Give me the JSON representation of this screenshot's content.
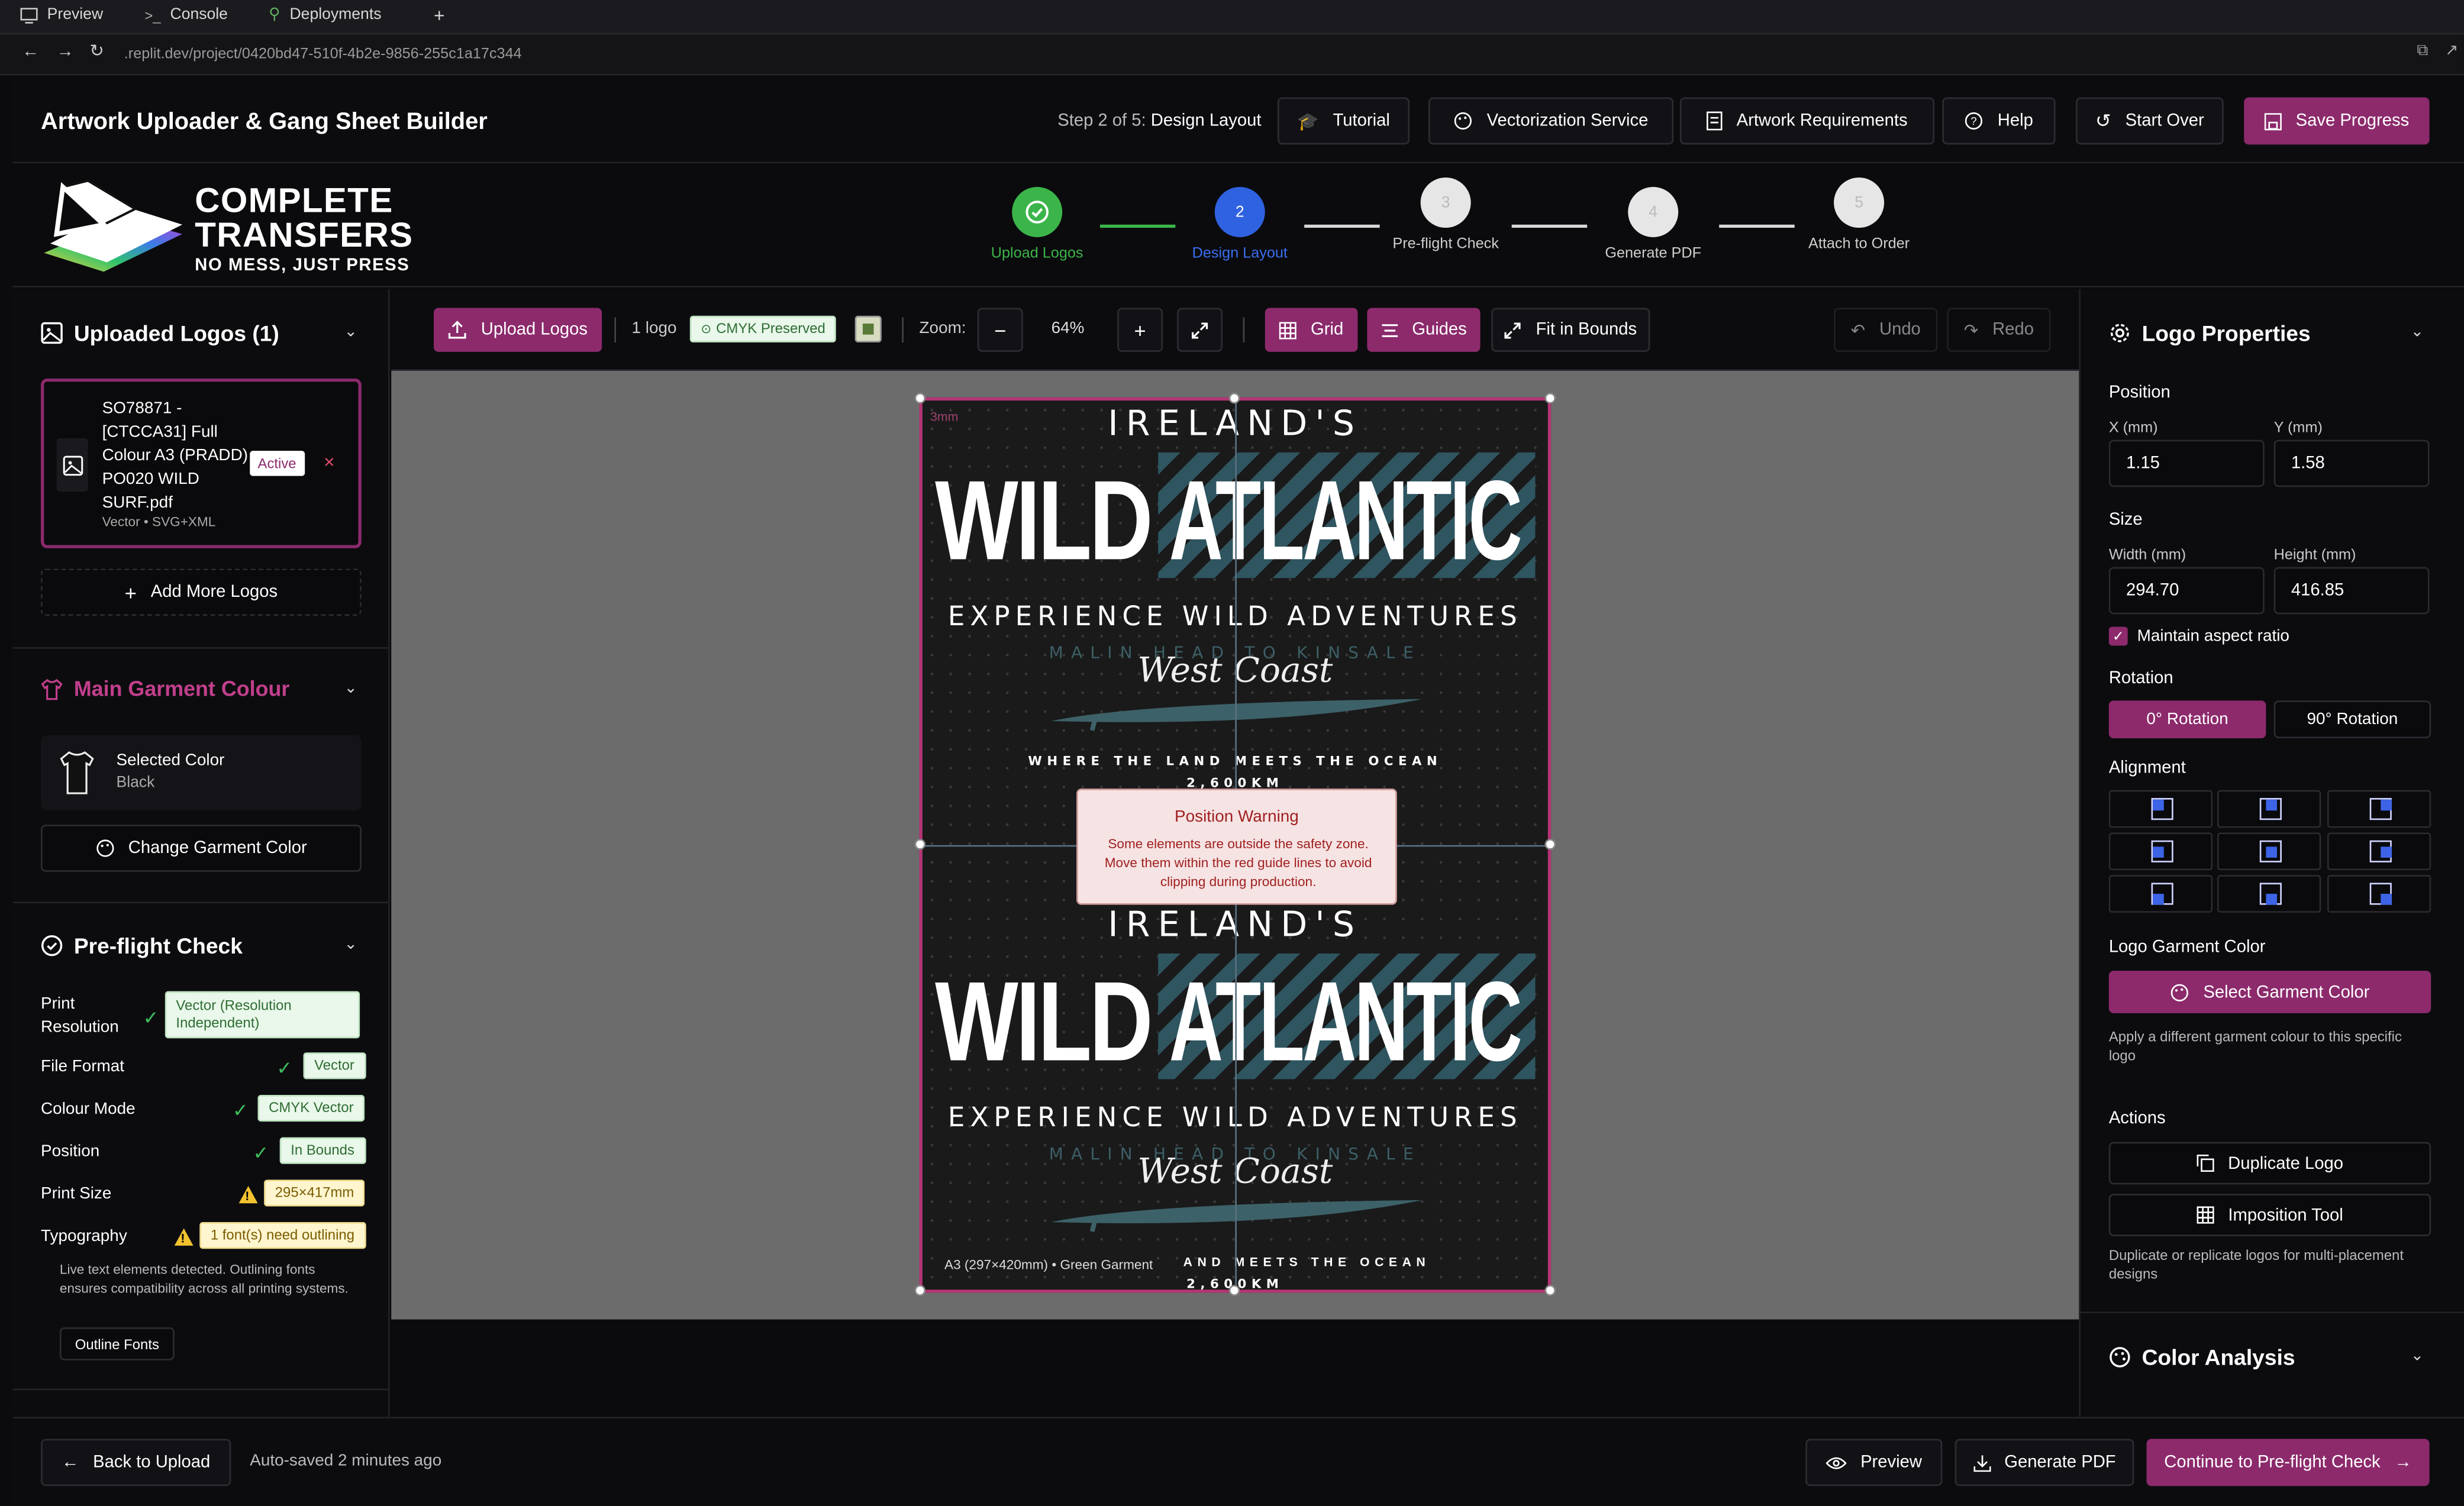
{
  "browser": {
    "tabs": [
      "Preview",
      "Console",
      "Deployments"
    ],
    "new_tab": "+",
    "url": ".replit.dev/project/0420bd47-510f-4b2e-9856-255c1a17c344"
  },
  "header": {
    "title": "Artwork Uploader & Gang Sheet Builder",
    "step_prefix": "Step 2 of 5:",
    "step_name": "Design Layout",
    "buttons": {
      "tutorial": "Tutorial",
      "vectorization": "Vectorization Service",
      "requirements": "Artwork Requirements",
      "help": "Help",
      "start_over": "Start Over",
      "save": "Save Progress"
    }
  },
  "brand": {
    "line1": "COMPLETE",
    "line2": "TRANSFERS",
    "tagline": "NO MESS, JUST PRESS"
  },
  "steps": [
    {
      "number": "1",
      "label": "Upload Logos",
      "state": "done"
    },
    {
      "number": "2",
      "label": "Design Layout",
      "state": "active"
    },
    {
      "number": "3",
      "label": "Pre-flight Check",
      "state": "pending"
    },
    {
      "number": "4",
      "label": "Generate PDF",
      "state": "pending"
    },
    {
      "number": "5",
      "label": "Attach to Order",
      "state": "pending"
    }
  ],
  "left": {
    "uploaded_title": "Uploaded Logos (1)",
    "file": {
      "name": "SO78871 - [CTCCA31] Full Colour A3 (PRADD) PO020 WILD SURF.pdf",
      "meta": "Vector • SVG+XML",
      "status": "Active",
      "remove": "×"
    },
    "add_more": "Add More Logos",
    "garment_title": "Main Garment Colour",
    "selected_label": "Selected Color",
    "selected_value": "Black",
    "change_color": "Change Garment Color",
    "preflight_title": "Pre-flight Check",
    "checks": [
      {
        "label": "Print Resolution",
        "value": "Vector (Resolution Independent)",
        "status": "ok"
      },
      {
        "label": "File Format",
        "value": "Vector",
        "status": "ok"
      },
      {
        "label": "Colour Mode",
        "value": "CMYK Vector",
        "status": "ok"
      },
      {
        "label": "Position",
        "value": "In Bounds",
        "status": "ok"
      },
      {
        "label": "Print Size",
        "value": "295×417mm",
        "status": "warn"
      },
      {
        "label": "Typography",
        "value": "1 font(s) need outlining",
        "status": "warn"
      }
    ],
    "typography_note": "Live text elements detected. Outlining fonts ensures compatibility across all printing systems.",
    "outline_button": "Outline Fonts"
  },
  "toolbar": {
    "upload": "Upload Logos",
    "count": "1 logo",
    "cmyk": "CMYK Preserved",
    "zoom_label": "Zoom:",
    "zoom_value": "64%",
    "zoom_out": "−",
    "zoom_in": "+",
    "grid": "Grid",
    "guides": "Guides",
    "fit": "Fit in Bounds",
    "undo": "Undo",
    "redo": "Redo"
  },
  "canvas": {
    "bleed": "3mm",
    "caption": "A3 (297×420mm) • Green Garment",
    "warning_title": "Position Warning",
    "warning_text": "Some elements are outside the safety zone. Move them within the red guide lines to avoid clipping during production.",
    "poster": {
      "line1": "IRELAND'S",
      "line2a": "WILD",
      "line2b": "ATLANTIC",
      "line3": "EXPERIENCE WILD ADVENTURES",
      "line4": "MALIN HEAD TO KINSALE",
      "script": "West Coast",
      "line5": "WHERE THE LAND MEETS THE OCEAN",
      "line6": "2,600KM",
      "line5b": "AND MEETS THE OCEAN"
    }
  },
  "right": {
    "title": "Logo Properties",
    "position_label": "Position",
    "x_label": "X (mm)",
    "x_value": "1.15",
    "y_label": "Y (mm)",
    "y_value": "1.58",
    "size_label": "Size",
    "w_label": "Width (mm)",
    "w_value": "294.70",
    "h_label": "Height (mm)",
    "h_value": "416.85",
    "aspect": "Maintain aspect ratio",
    "rotation_label": "Rotation",
    "rot0": "0° Rotation",
    "rot90": "90° Rotation",
    "alignment_label": "Alignment",
    "garment_label": "Logo Garment Color",
    "select_garment": "Select Garment Color",
    "garment_hint": "Apply a different garment colour to this specific logo",
    "actions_label": "Actions",
    "duplicate": "Duplicate Logo",
    "imposition": "Imposition Tool",
    "actions_hint": "Duplicate or replicate logos for multi-placement designs",
    "color_analysis": "Color Analysis"
  },
  "footer": {
    "back": "Back to Upload",
    "autosave": "Auto-saved 2 minutes ago",
    "preview": "Preview",
    "generate": "Generate PDF",
    "continue": "Continue to Pre-flight Check"
  },
  "colors": {
    "accent": "#8c2a6c",
    "step_done": "#3bb54a",
    "step_active": "#2f62e0",
    "garment_title": "#c23f8c"
  }
}
